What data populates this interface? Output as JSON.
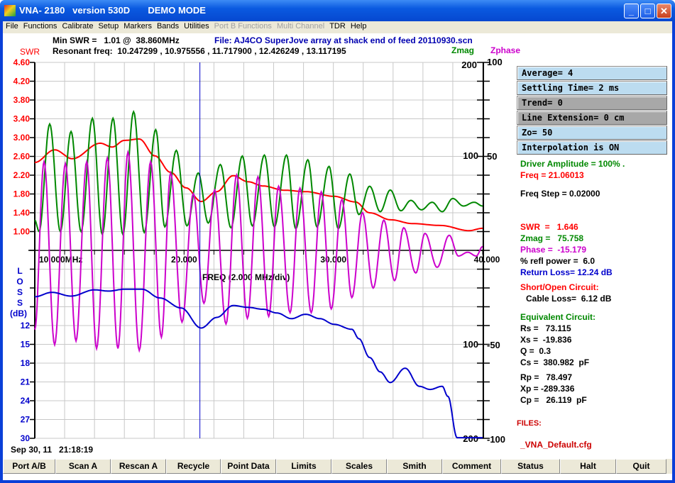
{
  "window": {
    "title": "VNA- 2180   version 530D       DEMO MODE",
    "minimize": "_",
    "maximize": "□",
    "close": "✕"
  },
  "menu": [
    {
      "label": "File",
      "enabled": true
    },
    {
      "label": "Functions",
      "enabled": true
    },
    {
      "label": "Calibrate",
      "enabled": true
    },
    {
      "label": "Setup",
      "enabled": true
    },
    {
      "label": "Markers",
      "enabled": true
    },
    {
      "label": "Bands",
      "enabled": true
    },
    {
      "label": "Utilities",
      "enabled": true
    },
    {
      "label": "Port B Functions",
      "enabled": false
    },
    {
      "label": "Multi Channel",
      "enabled": false
    },
    {
      "label": "TDR",
      "enabled": true
    },
    {
      "label": "Help",
      "enabled": true
    }
  ],
  "header": {
    "min_swr": "Min SWR =   1.01 @  38.860MHz",
    "file": "File: AJ4CO SuperJove array at shack end of feed 20110930.scn",
    "resonant": "Resonant freq:  10.247299 , 10.975556 , 11.717900 , 12.426249 , 13.117195",
    "swr_label": "SWR",
    "zmag_label": "Zmag",
    "zphase_label": "Zphase"
  },
  "panel_buttons": [
    {
      "label": "Average= 4",
      "style": "blue"
    },
    {
      "label": "Settling Time= 2 ms",
      "style": "blue"
    },
    {
      "label": "Trend= 0",
      "style": "gray"
    },
    {
      "label": "Line Extension= 0 cm",
      "style": "gray"
    },
    {
      "label": "Zo= 50",
      "style": "blue"
    },
    {
      "label": "Interpolation is ON",
      "style": "blue"
    }
  ],
  "readouts": {
    "driver": "Driver Amplitude = 100% .",
    "freq": "Freq = 21.06013",
    "freq_step": "Freq Step = 0.02000",
    "swr": "SWR  =   1.646",
    "zmag": "Zmag =   75.758",
    "phase": "Phase =  -15.179",
    "refl": "% refl power =  6.0",
    "return_loss": "Return Loss= 12.24 dB",
    "short_open": "Short/Open Circuit:",
    "cable_loss": "Cable Loss=  6.12 dB",
    "equiv": "Equivalent Circuit:",
    "rs": "Rs =   73.115",
    "xs": "Xs =  -19.836",
    "q": "Q =  0.3",
    "cs": "Cs =  380.982  pF",
    "rp": "Rp =   78.497",
    "xp": "Xp = -289.336",
    "cp": "Cp =   26.119  pF",
    "files_label": "FILES:",
    "file_name": "_VNA_Default.cfg"
  },
  "timestamp": "Sep 30, 11   21:18:19",
  "bottom_buttons": [
    "Port A/B",
    "Scan A",
    "Rescan A",
    "Recycle",
    "Point Data",
    "Limits",
    "Scales",
    "Smith",
    "Comment",
    "Status",
    "Halt",
    "Quit"
  ],
  "colors": {
    "swr": "#ff0000",
    "zmag": "#008800",
    "zphase": "#cc00cc",
    "loss": "#0000cc",
    "grid": "#c8c8c8",
    "cursor": "#0000cc"
  },
  "chart_data": {
    "type": "line",
    "grid": true,
    "cursor_freq": 21.06013,
    "x": {
      "label": "FREQ (2.000 MHz/div)",
      "range": [
        10,
        40
      ],
      "ticks": [
        "10.000MHz",
        "20.000",
        "30.000",
        "40.000"
      ],
      "tick_values": [
        10,
        20,
        30,
        40
      ]
    },
    "swr_axis": {
      "range": [
        1.0,
        4.6
      ],
      "ticks": [
        "4.60",
        "4.20",
        "3.80",
        "3.40",
        "3.00",
        "2.60",
        "2.20",
        "1.80",
        "1.40",
        "1.00"
      ]
    },
    "loss_axis": {
      "label_letters": [
        "L",
        "O",
        "S",
        "S",
        "(dB)"
      ],
      "range": [
        0,
        30
      ],
      "ticks": [
        "12",
        "15",
        "18",
        "21",
        "24",
        "27",
        "30"
      ],
      "tick_values": [
        12,
        15,
        18,
        21,
        24,
        27,
        30
      ]
    },
    "zmag_axis": {
      "ticks": [
        "200",
        "100",
        "100",
        "200"
      ],
      "tick_values": [
        200,
        100,
        -100,
        -200
      ]
    },
    "zphase_axis": {
      "range": [
        -100,
        100
      ],
      "ticks": [
        "100",
        "50",
        "-50",
        "-100"
      ],
      "tick_values": [
        100,
        50,
        -50,
        -100
      ]
    },
    "series": [
      {
        "name": "SWR",
        "axis": "swr",
        "color": "#ff0000",
        "points": [
          [
            10,
            2.47
          ],
          [
            11.33,
            2.74
          ],
          [
            12.52,
            2.55
          ],
          [
            14.38,
            2.88
          ],
          [
            15.19,
            2.8
          ],
          [
            16.0,
            2.94
          ],
          [
            17.0,
            2.97
          ],
          [
            18.05,
            2.61
          ],
          [
            19.1,
            2.26
          ],
          [
            20.14,
            1.93
          ],
          [
            21.14,
            1.64
          ],
          [
            22.19,
            1.85
          ],
          [
            23.29,
            2.19
          ],
          [
            24.29,
            2.06
          ],
          [
            25.29,
            1.97
          ],
          [
            26.71,
            1.88
          ],
          [
            28.14,
            1.85
          ],
          [
            30.05,
            1.75
          ],
          [
            31.48,
            1.63
          ],
          [
            32.43,
            1.4
          ],
          [
            33.86,
            1.25
          ],
          [
            35.29,
            1.17
          ],
          [
            37.19,
            1.13
          ],
          [
            39.1,
            1.02
          ],
          [
            40,
            1.07
          ]
        ]
      },
      {
        "name": "Zmag",
        "axis": "zmag",
        "color": "#008800",
        "points": [
          [
            10,
            32
          ],
          [
            10.29,
            20
          ],
          [
            11.0,
            134
          ],
          [
            11.71,
            20
          ],
          [
            12.43,
            126
          ],
          [
            13.1,
            20
          ],
          [
            13.86,
            140
          ],
          [
            14.52,
            17
          ],
          [
            15.24,
            140
          ],
          [
            15.9,
            17
          ],
          [
            16.62,
            147
          ],
          [
            17.33,
            19
          ],
          [
            18.1,
            128
          ],
          [
            18.71,
            25
          ],
          [
            19.48,
            106
          ],
          [
            20.19,
            26
          ],
          [
            20.95,
            82
          ],
          [
            21.62,
            29
          ],
          [
            22.43,
            91
          ],
          [
            23.14,
            24
          ],
          [
            23.9,
            100
          ],
          [
            24.57,
            26
          ],
          [
            25.38,
            101
          ],
          [
            26.05,
            25
          ],
          [
            26.86,
            101
          ],
          [
            27.48,
            23
          ],
          [
            28.29,
            96
          ],
          [
            28.9,
            25
          ],
          [
            29.71,
            89
          ],
          [
            30.33,
            23
          ],
          [
            31.1,
            81
          ],
          [
            31.71,
            38
          ],
          [
            32.43,
            68
          ],
          [
            33.14,
            41
          ],
          [
            33.81,
            64
          ],
          [
            34.52,
            42
          ],
          [
            35.19,
            53
          ],
          [
            35.9,
            43
          ],
          [
            36.62,
            51
          ],
          [
            37.29,
            41
          ],
          [
            38.0,
            55
          ],
          [
            38.71,
            47
          ],
          [
            39.43,
            51
          ],
          [
            40,
            47
          ]
        ]
      },
      {
        "name": "Zphase",
        "axis": "zphase",
        "color": "#cc00cc",
        "points": [
          [
            10,
            -42
          ],
          [
            10.62,
            47
          ],
          [
            11.33,
            -50
          ],
          [
            12.05,
            46
          ],
          [
            12.76,
            -48
          ],
          [
            13.48,
            47
          ],
          [
            14.14,
            -52
          ],
          [
            14.86,
            49
          ],
          [
            15.57,
            -52
          ],
          [
            16.24,
            52
          ],
          [
            17.0,
            -53
          ],
          [
            17.76,
            47
          ],
          [
            18.48,
            -46
          ],
          [
            19.1,
            41
          ],
          [
            19.86,
            -38
          ],
          [
            20.62,
            30
          ],
          [
            21.33,
            -28
          ],
          [
            22.05,
            32
          ],
          [
            22.81,
            -39
          ],
          [
            23.52,
            40
          ],
          [
            24.24,
            -36
          ],
          [
            24.95,
            39
          ],
          [
            25.67,
            -35
          ],
          [
            26.33,
            34
          ],
          [
            27.1,
            -33
          ],
          [
            27.76,
            33
          ],
          [
            28.52,
            -33
          ],
          [
            29.19,
            31
          ],
          [
            29.86,
            -31
          ],
          [
            30.57,
            27
          ],
          [
            31.24,
            -25
          ],
          [
            31.95,
            20
          ],
          [
            32.67,
            -20
          ],
          [
            33.38,
            16
          ],
          [
            34.1,
            -16
          ],
          [
            34.71,
            12
          ],
          [
            35.52,
            -12
          ],
          [
            36.14,
            9
          ],
          [
            36.95,
            -9
          ],
          [
            37.76,
            8
          ],
          [
            38.38,
            -3
          ],
          [
            39.0,
            -1
          ],
          [
            39.57,
            -3
          ],
          [
            40,
            2
          ]
        ]
      },
      {
        "name": "LOSS",
        "axis": "loss",
        "color": "#0000cc",
        "points": [
          [
            10,
            7.4
          ],
          [
            11.14,
            6.7
          ],
          [
            12.43,
            7.3
          ],
          [
            14,
            6.3
          ],
          [
            14.95,
            6.5
          ],
          [
            16,
            6.2
          ],
          [
            17.19,
            6.2
          ],
          [
            18.38,
            7.6
          ],
          [
            19.81,
            9.2
          ],
          [
            21.14,
            12.4
          ],
          [
            22.19,
            10.7
          ],
          [
            23.29,
            8.8
          ],
          [
            24.29,
            9.1
          ],
          [
            25.29,
            9.4
          ],
          [
            26.24,
            10.0
          ],
          [
            27.19,
            10.9
          ],
          [
            28.14,
            10.2
          ],
          [
            29.1,
            10.9
          ],
          [
            30.05,
            11.8
          ],
          [
            31.24,
            12.6
          ],
          [
            31.71,
            14.1
          ],
          [
            32.43,
            17.1
          ],
          [
            33.14,
            19.4
          ],
          [
            33.81,
            21.1
          ],
          [
            34.81,
            18.8
          ],
          [
            35.76,
            21.7
          ],
          [
            36.48,
            22.2
          ],
          [
            37.29,
            21.7
          ],
          [
            37.67,
            23.3
          ],
          [
            38.29,
            29.9
          ],
          [
            40,
            29.9
          ]
        ]
      }
    ]
  }
}
